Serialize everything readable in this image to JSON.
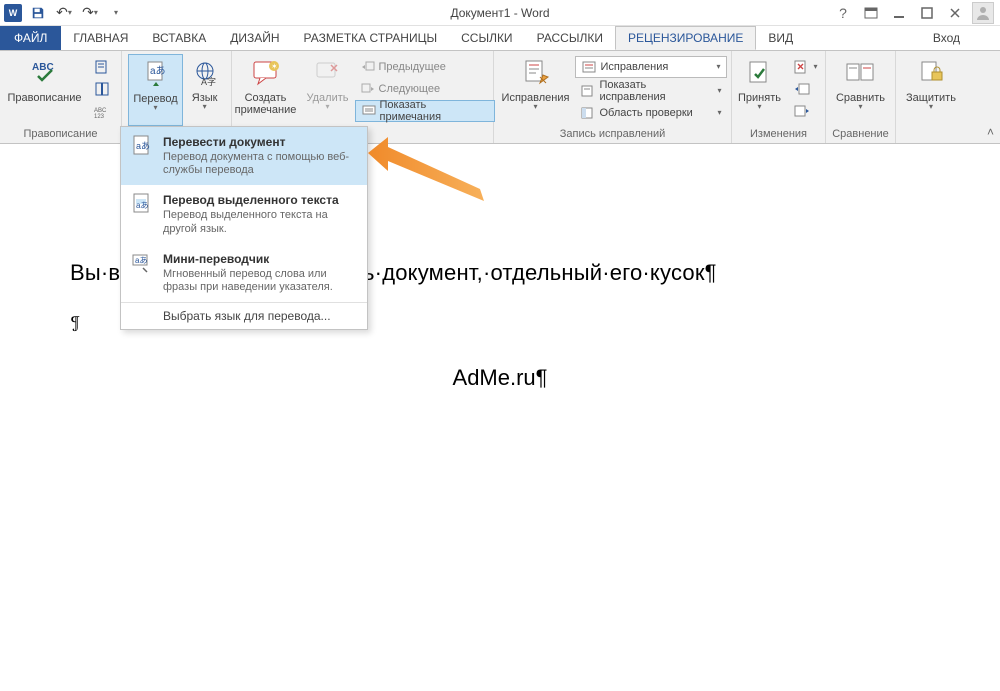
{
  "titlebar": {
    "app_glyph": "W",
    "title": "Документ1 - Word",
    "help": "?",
    "login": "Вход"
  },
  "tabs": {
    "file": "ФАЙЛ",
    "items": [
      "ГЛАВНАЯ",
      "ВСТАВКА",
      "ДИЗАЙН",
      "РАЗМЕТКА СТРАНИЦЫ",
      "ССЫЛКИ",
      "РАССЫЛКИ",
      "РЕЦЕНЗИРОВАНИЕ",
      "ВИД"
    ],
    "active_index": 6
  },
  "ribbon": {
    "groups": {
      "proofing": {
        "label": "Правописание",
        "spelling": "Правописание",
        "abc": "ABC"
      },
      "language": {
        "translate": "Перевод",
        "lang": "Язык",
        "label_remainder": "ния"
      },
      "comments": {
        "new_comment": "Создать\nпримечание",
        "delete": "Удалить",
        "previous": "Предыдущее",
        "next": "Следующее",
        "show_comments": "Показать примечания"
      },
      "tracking": {
        "label": "Запись исправлений",
        "track_changes": "Исправления",
        "dropdown1": "Исправления",
        "show_markup": "Показать исправления",
        "reviewing_pane": "Область проверки"
      },
      "changes": {
        "label": "Изменения",
        "accept": "Принять"
      },
      "compare": {
        "label": "Сравнение",
        "compare": "Сравнить"
      },
      "protect": {
        "protect": "Защитить"
      }
    }
  },
  "translate_menu": {
    "items": [
      {
        "title": "Перевести документ",
        "desc": "Перевод документа с помощью веб-службы перевода"
      },
      {
        "title": "Перевод выделенного текста",
        "desc": "Перевод выделенного текста на другой язык."
      },
      {
        "title": "Мини-переводчик",
        "desc": "Мгновенный перевод слова или фразы при наведении указателя."
      }
    ],
    "footer": "Выбрать язык для перевода...",
    "selected_index": 0
  },
  "document": {
    "line1_prefix": "Вы·в",
    "line1_suffix": "ь·документ,·отдельный·его·кусок¶",
    "pilcrow": "¶",
    "center": "AdMe.ru¶"
  }
}
